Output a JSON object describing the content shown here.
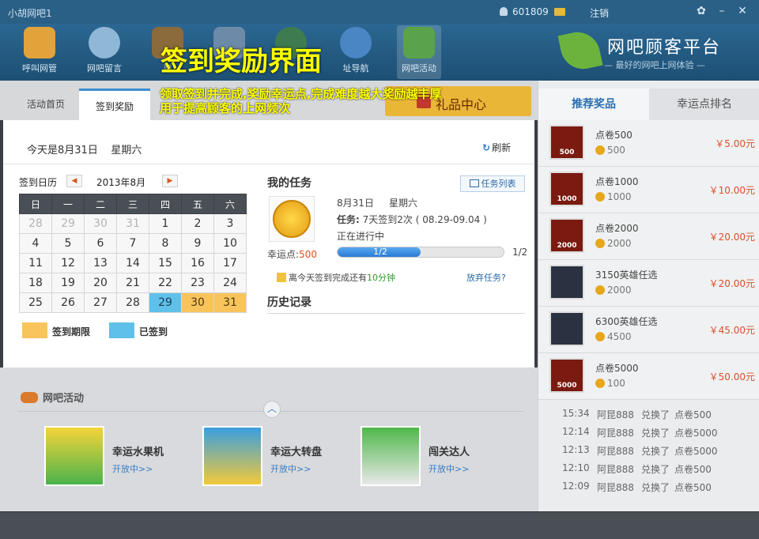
{
  "window": {
    "title": "小胡网吧1",
    "user_id": "601809",
    "logout": "注销",
    "min_btn": "–",
    "close_btn": "✕"
  },
  "nav": [
    {
      "label": "呼叫网管"
    },
    {
      "label": "网吧留言"
    },
    {
      "label": "商"
    },
    {
      "label": "址导航"
    },
    {
      "label": "网吧活动"
    }
  ],
  "brand": {
    "name": "网吧顾客平台",
    "slogan": "— 最好的网吧上网体验 —"
  },
  "tabs": {
    "home": "活动首页",
    "signin": "签到奖励",
    "gift_center": "礼品中心"
  },
  "annotation": {
    "title": "签到奖励界面",
    "line1": "领取签到并完成,奖励幸运点,完成难度越大奖励越丰厚",
    "line2": "用于提高顾客的上网频次"
  },
  "popup": {
    "today": "今天是8月31日",
    "weekday": "星期六",
    "refresh": "刷新",
    "calendar": {
      "label": "签到日历",
      "month": "2013年8月",
      "prev": "◀",
      "next": "▶",
      "weekdays": [
        "日",
        "一",
        "二",
        "三",
        "四",
        "五",
        "六"
      ],
      "rows": [
        [
          {
            "d": "28",
            "s": "prev"
          },
          {
            "d": "29",
            "s": "prev"
          },
          {
            "d": "30",
            "s": "prev"
          },
          {
            "d": "31",
            "s": "prev"
          },
          {
            "d": "1",
            "s": ""
          },
          {
            "d": "2",
            "s": ""
          },
          {
            "d": "3",
            "s": ""
          }
        ],
        [
          {
            "d": "4",
            "s": ""
          },
          {
            "d": "5",
            "s": ""
          },
          {
            "d": "6",
            "s": ""
          },
          {
            "d": "7",
            "s": ""
          },
          {
            "d": "8",
            "s": ""
          },
          {
            "d": "9",
            "s": ""
          },
          {
            "d": "10",
            "s": ""
          }
        ],
        [
          {
            "d": "11",
            "s": ""
          },
          {
            "d": "12",
            "s": ""
          },
          {
            "d": "13",
            "s": ""
          },
          {
            "d": "14",
            "s": ""
          },
          {
            "d": "15",
            "s": ""
          },
          {
            "d": "16",
            "s": ""
          },
          {
            "d": "17",
            "s": ""
          }
        ],
        [
          {
            "d": "18",
            "s": ""
          },
          {
            "d": "19",
            "s": ""
          },
          {
            "d": "20",
            "s": ""
          },
          {
            "d": "21",
            "s": ""
          },
          {
            "d": "22",
            "s": ""
          },
          {
            "d": "23",
            "s": ""
          },
          {
            "d": "24",
            "s": ""
          }
        ],
        [
          {
            "d": "25",
            "s": ""
          },
          {
            "d": "26",
            "s": ""
          },
          {
            "d": "27",
            "s": ""
          },
          {
            "d": "28",
            "s": ""
          },
          {
            "d": "29",
            "s": "done"
          },
          {
            "d": "30",
            "s": "limit"
          },
          {
            "d": "31",
            "s": "limit"
          }
        ]
      ]
    },
    "legend": {
      "limit": "签到期限",
      "done": "已签到",
      "limit_color": "#f9c45c",
      "done_color": "#5fc1ea"
    },
    "task": {
      "title": "我的任务",
      "list_button": "任务列表",
      "date": "8月31日",
      "weekday": "星期六",
      "desc_label": "任务:",
      "desc": "7天签到2次 ( 08.29-09.04 )",
      "state": "正在进行中",
      "lucky_label": "幸运点:",
      "lucky_value": "500",
      "progress_text": "1/2",
      "progress_count": "1/2",
      "progress_fraction": 0.5,
      "remain_prefix": "离今天签到完成还有",
      "remain_minutes": "10分钟",
      "giveup": "放弃任务?"
    },
    "history": {
      "title": "历史记录"
    }
  },
  "right_panel": {
    "tabs": [
      "推荐奖品",
      "幸运点排名"
    ],
    "prizes": [
      {
        "name": "点卷500",
        "points": "500",
        "price": "￥5.00元",
        "badge": "500",
        "kind": "card"
      },
      {
        "name": "点卷1000",
        "points": "1000",
        "price": "￥10.00元",
        "badge": "1000",
        "kind": "card"
      },
      {
        "name": "点卷2000",
        "points": "2000",
        "price": "￥20.00元",
        "badge": "2000",
        "kind": "card"
      },
      {
        "name": "3150英雄任选",
        "points": "2000",
        "price": "￥20.00元",
        "badge": "",
        "kind": "hero"
      },
      {
        "name": "6300英雄任选",
        "points": "4500",
        "price": "￥45.00元",
        "badge": "",
        "kind": "hero"
      },
      {
        "name": "点卷5000",
        "points": "100",
        "price": "￥50.00元",
        "badge": "5000",
        "kind": "card"
      }
    ],
    "logs": [
      {
        "time": "15:34",
        "user": "阿昆888",
        "action": "兑换了",
        "item": "点卷500"
      },
      {
        "time": "12:14",
        "user": "阿昆888",
        "action": "兑换了",
        "item": "点卷5000"
      },
      {
        "time": "12:13",
        "user": "阿昆888",
        "action": "兑换了",
        "item": "点卷5000"
      },
      {
        "time": "12:10",
        "user": "阿昆888",
        "action": "兑换了",
        "item": "点卷500"
      },
      {
        "time": "12:09",
        "user": "阿昆888",
        "action": "兑换了",
        "item": "点卷500"
      }
    ]
  },
  "activities": {
    "title": "网吧活动",
    "collapse": "︿",
    "items": [
      {
        "name": "幸运水果机",
        "status": "开放中>>"
      },
      {
        "name": "幸运大转盘",
        "status": "开放中>>"
      },
      {
        "name": "闯关达人",
        "status": "开放中>>"
      }
    ]
  }
}
